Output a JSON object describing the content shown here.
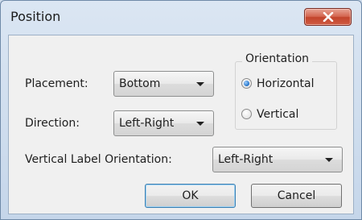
{
  "window": {
    "title": "Position"
  },
  "placement": {
    "label": "Placement:",
    "value": "Bottom"
  },
  "direction": {
    "label": "Direction:",
    "value": "Left-Right"
  },
  "orientation": {
    "legend": "Orientation",
    "options": [
      {
        "label": "Horizontal",
        "checked": true
      },
      {
        "label": "Vertical",
        "checked": false
      }
    ]
  },
  "vertical_label": {
    "label": "Vertical Label Orientation:",
    "value": "Left-Right"
  },
  "buttons": {
    "ok": "OK",
    "cancel": "Cancel"
  },
  "icons": {
    "close": "close-icon",
    "dropdown": "chevron-down-icon"
  },
  "colors": {
    "close_button": "#c9503a",
    "default_button_border": "#3c7fb1",
    "radio_selected": "#1f6fc6"
  }
}
